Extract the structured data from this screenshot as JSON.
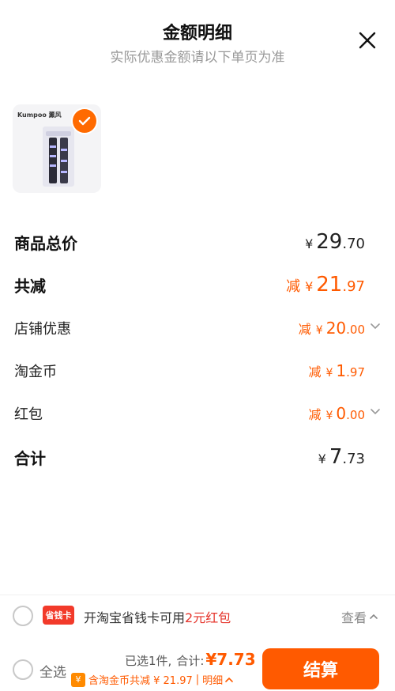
{
  "header": {
    "title": "金额明细",
    "subtitle": "实际优惠金额请以下单页为准",
    "close_icon": "close-icon"
  },
  "product": {
    "brand": "Kumpoo 薰风",
    "selected": true,
    "check_icon": "checkmark-icon"
  },
  "summary": {
    "total": {
      "label": "商品总价",
      "yen": "¥",
      "int": "29",
      "dec": ".70"
    },
    "reduced": {
      "label": "共减",
      "prefix": "减",
      "yen": "¥",
      "int": "21",
      "dec": ".97"
    },
    "store_discount": {
      "label": "店铺优惠",
      "prefix": "减",
      "yen": "¥",
      "int": "20",
      "dec": ".00"
    },
    "taobao_coin": {
      "label": "淘金币",
      "prefix": "减",
      "yen": "¥",
      "int": "1",
      "dec": ".97"
    },
    "red_packet": {
      "label": "红包",
      "prefix": "减",
      "yen": "¥",
      "int": "0",
      "dec": ".00"
    },
    "grand_total": {
      "label": "合计",
      "yen": "¥",
      "int": "7",
      "dec": ".73"
    }
  },
  "promo": {
    "badge": "省钱卡",
    "text_before": "开淘宝省钱卡可用",
    "text_highlight": "2元红包",
    "view_label": "查看"
  },
  "footer": {
    "select_all": "全选",
    "selected_count": "已选1件,",
    "total_label": "合计:",
    "total_amount": "¥7.73",
    "coin_icon_label": "¥",
    "coin_text": "含淘金币共减 ¥ 21.97",
    "separator": "|",
    "detail_label": "明细",
    "checkout_label": "结算"
  },
  "colors": {
    "accent": "#ff5a00",
    "badge_red": "#f23a2a"
  }
}
